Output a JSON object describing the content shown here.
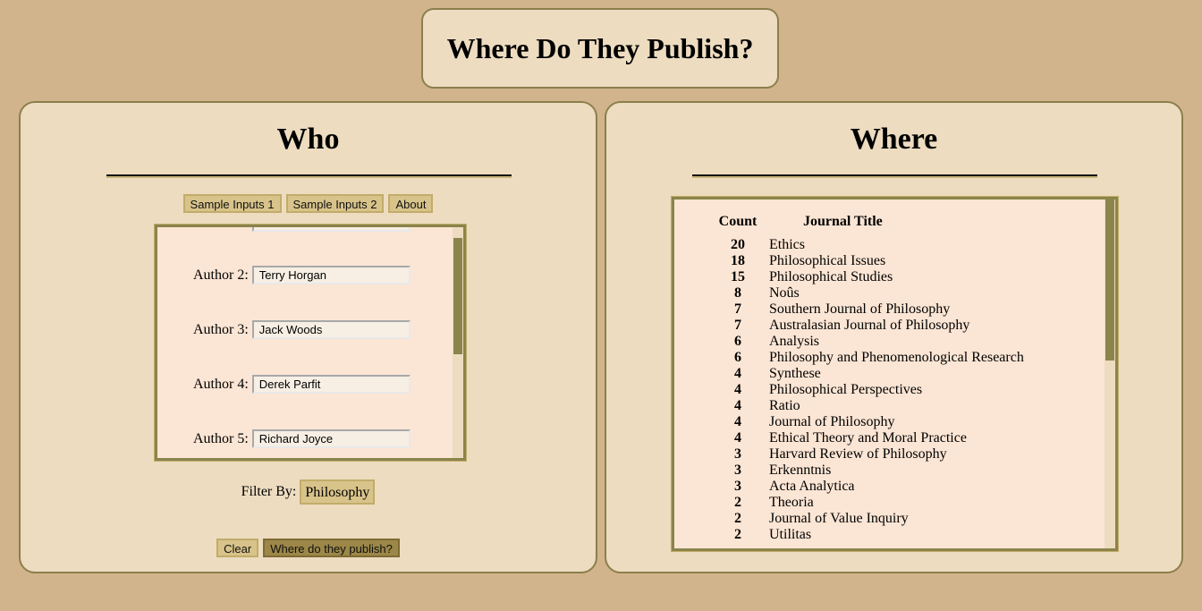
{
  "header": {
    "title": "Where Do They Publish?"
  },
  "who": {
    "heading": "Who",
    "buttons": {
      "sample1": "Sample Inputs 1",
      "sample2": "Sample Inputs 2",
      "about": "About"
    },
    "authors": [
      {
        "label": "Author 2:",
        "value": "Terry Horgan"
      },
      {
        "label": "Author 3:",
        "value": "Jack Woods"
      },
      {
        "label": "Author 4:",
        "value": "Derek Parfit"
      },
      {
        "label": "Author 5:",
        "value": "Richard Joyce"
      }
    ],
    "filter": {
      "label": "Filter By:",
      "selected": "Philosophy"
    },
    "actions": {
      "clear": "Clear",
      "submit": "Where do they publish?"
    }
  },
  "where": {
    "heading": "Where",
    "columns": {
      "count": "Count",
      "title": "Journal Title"
    },
    "rows": [
      {
        "count": "20",
        "title": "Ethics"
      },
      {
        "count": "18",
        "title": "Philosophical Issues"
      },
      {
        "count": "15",
        "title": "Philosophical Studies"
      },
      {
        "count": "8",
        "title": "Noûs"
      },
      {
        "count": "7",
        "title": "Southern Journal of Philosophy"
      },
      {
        "count": "7",
        "title": "Australasian Journal of Philosophy"
      },
      {
        "count": "6",
        "title": "Analysis"
      },
      {
        "count": "6",
        "title": "Philosophy and Phenomenological Research"
      },
      {
        "count": "4",
        "title": "Synthese"
      },
      {
        "count": "4",
        "title": "Philosophical Perspectives"
      },
      {
        "count": "4",
        "title": "Ratio"
      },
      {
        "count": "4",
        "title": "Journal of Philosophy"
      },
      {
        "count": "4",
        "title": "Ethical Theory and Moral Practice"
      },
      {
        "count": "3",
        "title": "Harvard Review of Philosophy"
      },
      {
        "count": "3",
        "title": "Erkenntnis"
      },
      {
        "count": "3",
        "title": "Acta Analytica"
      },
      {
        "count": "2",
        "title": "Theoria"
      },
      {
        "count": "2",
        "title": "Journal of Value Inquiry"
      },
      {
        "count": "2",
        "title": "Utilitas"
      }
    ]
  },
  "colors": {
    "page_bg": "#d2b48c",
    "panel_bg": "#eddcc0",
    "panel_border": "#8b7f4c",
    "list_bg": "#fbe5d4",
    "button_bg": "#d8c38a",
    "primary_button_bg": "#9c8748"
  }
}
